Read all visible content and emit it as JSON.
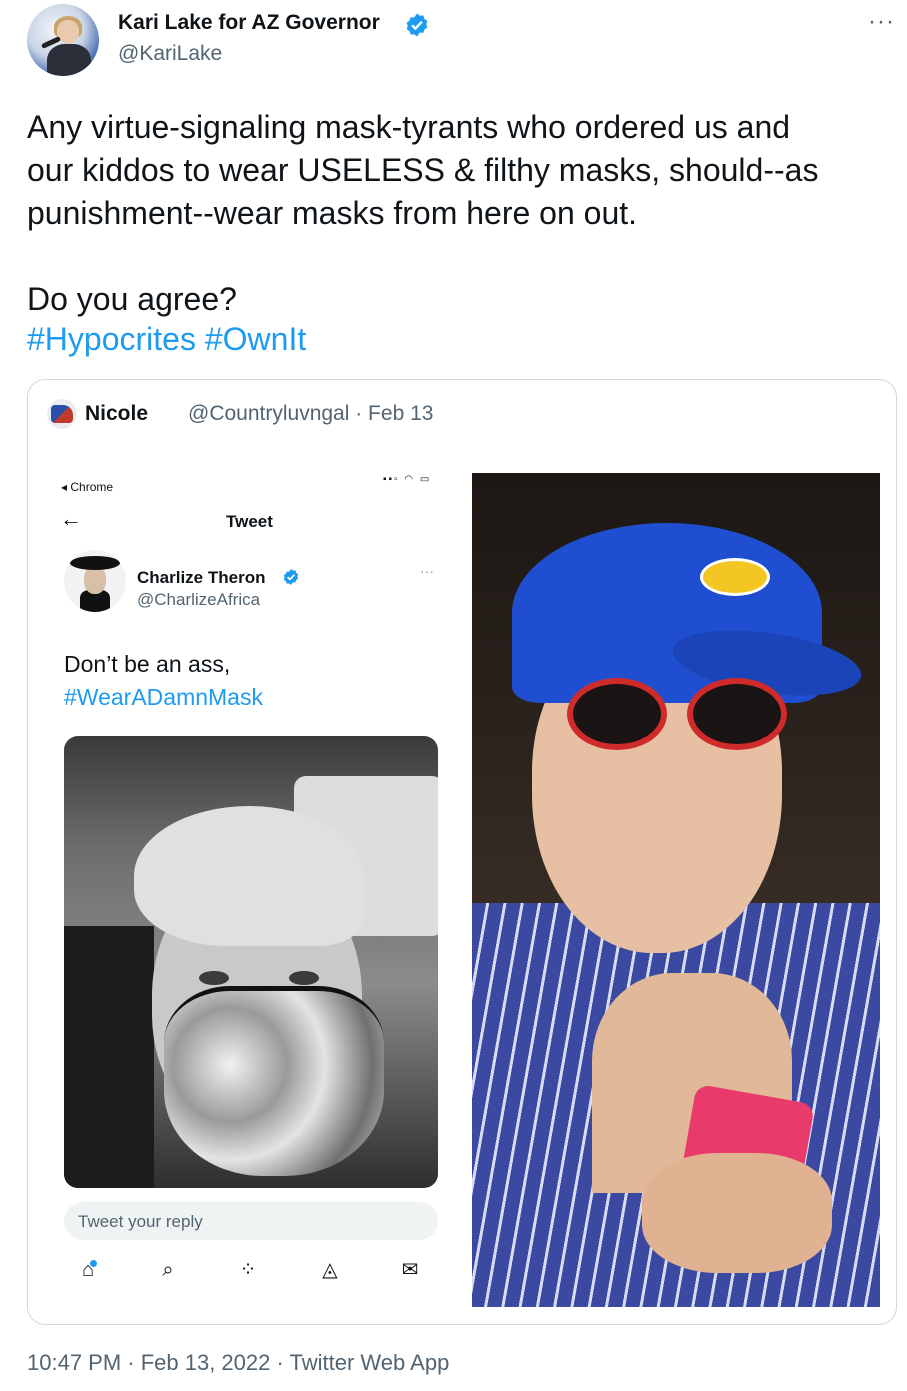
{
  "tweet": {
    "author_name": "Kari Lake for AZ Governor",
    "author_handle": "@KariLake",
    "more_label": "···",
    "text": "Any virtue-signaling mask-tyrants who ordered us and\nour kiddos to wear USELESS & filthy masks, should--as\npunishment--wear masks from here on out.\n\nDo you agree?",
    "hashtag_1": "#Hypocrites",
    "hashtag_2": "#OwnIt",
    "timestamp": "10:47 PM · Feb 13, 2022 · Twitter Web App"
  },
  "quoted": {
    "name": "Nicole",
    "handle_date": "@Countryluvngal · Feb 13"
  },
  "phone_screenshot": {
    "status_app": "◂ Chrome",
    "signal": "▪▪▫ ◠ ▭",
    "back_icon": "back-arrow-icon",
    "title": "Tweet",
    "name": "Charlize Theron",
    "handle": "@CharlizeAfrica",
    "more_label": "···",
    "text": "Don’t be an ass,",
    "hashtag": "#WearADamnMask",
    "reply_placeholder": "Tweet your reply"
  },
  "colors": {
    "link": "#1d9bf0",
    "secondary_text": "#536471",
    "border": "#cfd9de"
  }
}
